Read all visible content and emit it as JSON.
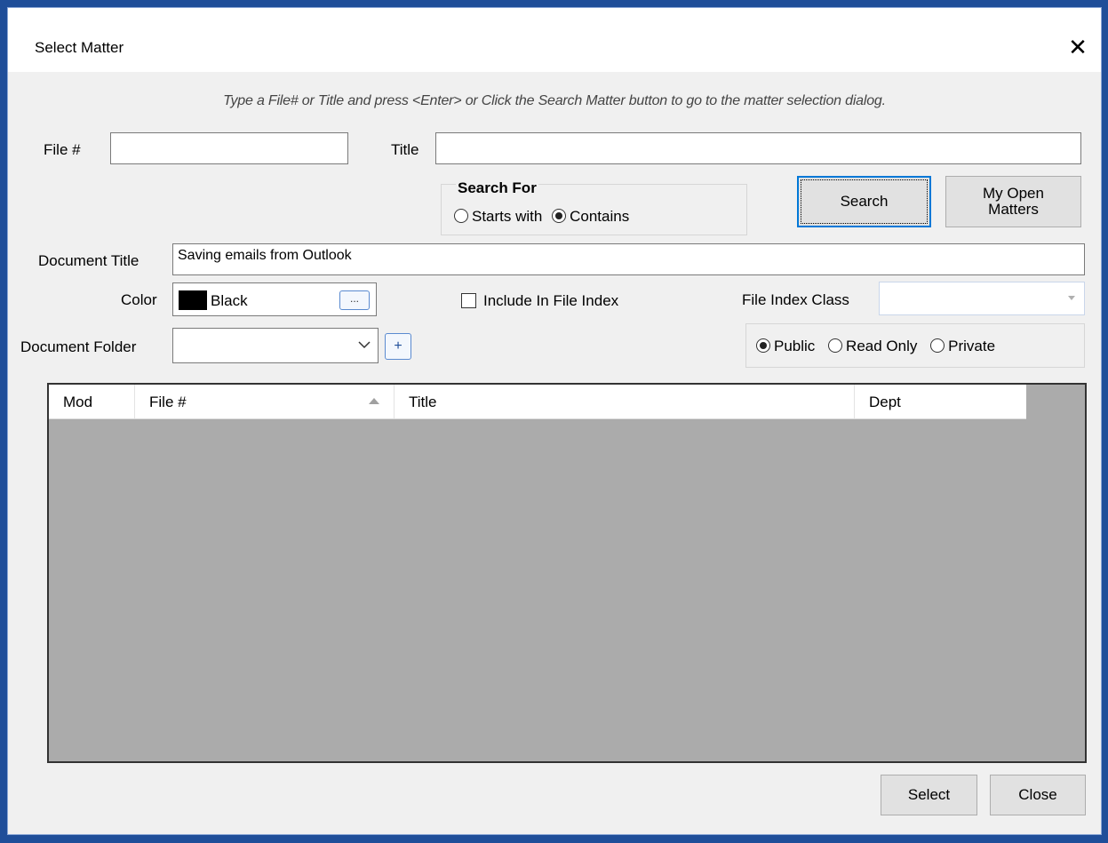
{
  "window": {
    "title": "Select Matter",
    "close_glyph": "✕"
  },
  "instruction": "Type a File# or Title and press <Enter> or Click the Search Matter button to go to the matter selection dialog.",
  "search": {
    "file_label": "File #",
    "file_value": "",
    "title_label": "Title",
    "title_value": "",
    "search_for_label": "Search For",
    "option_starts_with": "Starts with",
    "option_contains": "Contains",
    "selected_option": "Contains",
    "search_button": "Search",
    "my_open_matters_button": "My Open Matters"
  },
  "document": {
    "title_label": "Document Title",
    "title_value": "Saving emails from Outlook",
    "color_label": "Color",
    "color_value": "Black",
    "color_swatch": "#000000",
    "color_button": "...",
    "include_in_index_label": "Include In File Index",
    "include_in_index_checked": false,
    "file_index_class_label": "File Index Class",
    "file_index_class_value": "",
    "folder_label": "Document Folder",
    "folder_value": "",
    "add_folder_button": "+",
    "access_public": "Public",
    "access_read_only": "Read Only",
    "access_private": "Private",
    "access_selected": "Public"
  },
  "grid": {
    "columns": [
      "Mod",
      "File #",
      "Title",
      "Dept"
    ],
    "sorted_column": "File #",
    "rows": []
  },
  "footer": {
    "select_button": "Select",
    "close_button": "Close"
  },
  "colors": {
    "desktop": "#1f4e99",
    "accent": "#0078d7",
    "grid_background": "#ababab"
  }
}
